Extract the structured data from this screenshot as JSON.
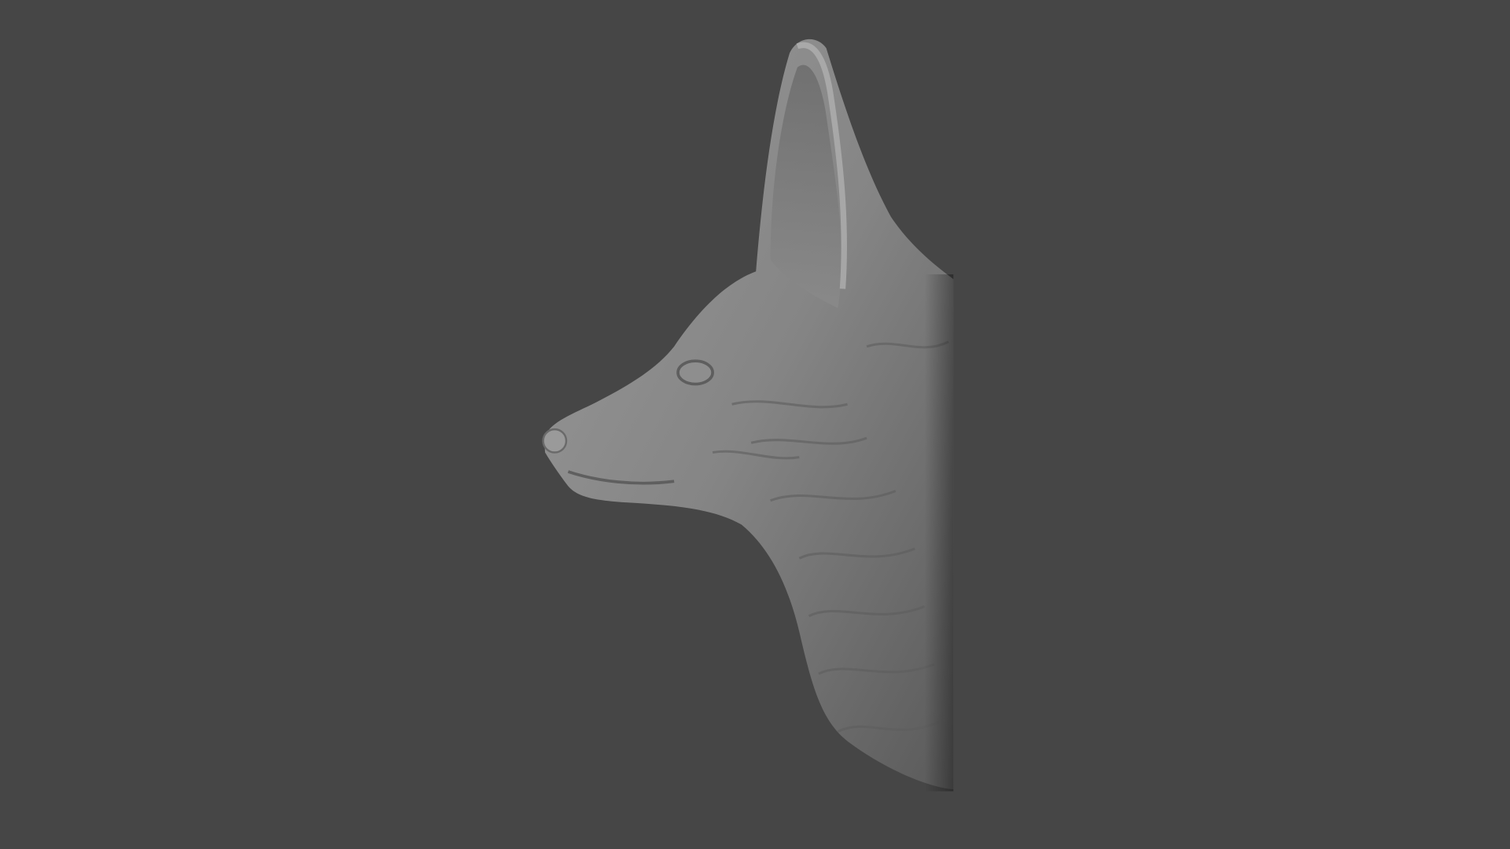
{
  "scene": {
    "colors": {
      "background": "#464646",
      "clay_light": "#9a9a9a",
      "clay_mid": "#7a7a7a",
      "clay_dark": "#505050"
    }
  }
}
